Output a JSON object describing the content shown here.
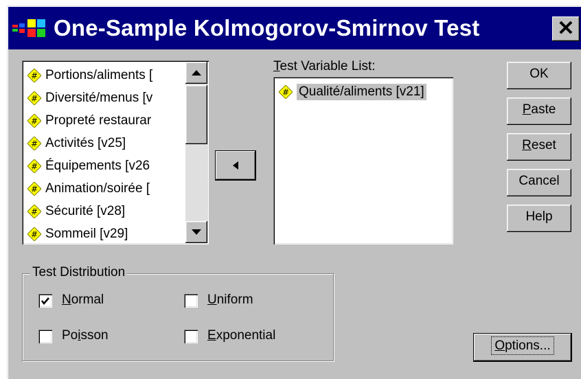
{
  "title": "One-Sample Kolmogorov-Smirnov Test",
  "close_glyph": "✕",
  "source_list": {
    "items": [
      "Portions/aliments [",
      "Diversité/menus [v",
      "Propreté restaurar",
      "Activités [v25]",
      "Équipements [v26",
      "Animation/soirée [",
      "Sécurité [v28]",
      "Sommeil [v29]"
    ]
  },
  "move_button_glyph": "◀",
  "test_variable": {
    "label_u": "T",
    "label_rest": "est Variable List:",
    "items": [
      "Qualité/aliments [v21]"
    ]
  },
  "buttons": {
    "ok": "OK",
    "paste_u": "P",
    "paste_rest": "aste",
    "reset_u": "R",
    "reset_rest": "eset",
    "cancel": "Cancel",
    "help": "Help",
    "options_u": "O",
    "options_rest": "ptions..."
  },
  "distribution": {
    "label": "Test Distribution",
    "normal_u": "N",
    "normal_rest": "ormal",
    "normal_checked": true,
    "uniform_u": "U",
    "uniform_rest": "niform",
    "uniform_checked": false,
    "poisson_pre": "Po",
    "poisson_u": "i",
    "poisson_rest": "sson",
    "poisson_checked": false,
    "exponential_u": "E",
    "exponential_rest": "xponential",
    "exponential_checked": false
  },
  "icons": {
    "variable": "numeric-variable-icon",
    "app": "spss-app-icon"
  },
  "colors": {
    "titlebar": "#000080",
    "face": "#c0c0c0",
    "icon_fill": "#ffff00"
  }
}
